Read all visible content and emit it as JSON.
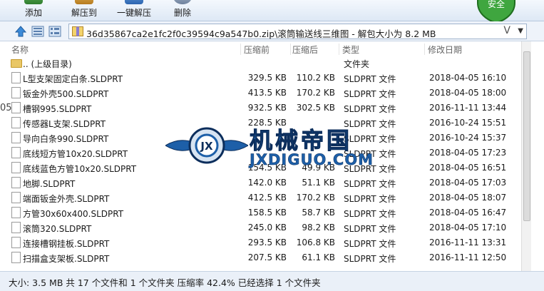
{
  "toolbar": {
    "buttons": [
      {
        "label": "添加",
        "icon": "add-icon",
        "color": "#3d8f3d"
      },
      {
        "label": "解压到",
        "icon": "extract-to-icon",
        "color": "#c08a2a"
      },
      {
        "label": "一键解压",
        "icon": "one-click-extract-icon",
        "color": "#3b78c4"
      },
      {
        "label": "删除",
        "icon": "delete-icon",
        "color": "#7c8ea8"
      }
    ],
    "shield_text": "安全"
  },
  "address": {
    "path": "36d35867ca2e1fc2f0c39594c9a547b0.zip\\滚筒输送线三维图 - 解包大小为 8.2 MB",
    "dropdown_glyph": "V"
  },
  "columns": {
    "name": "名称",
    "size": "压缩前",
    "packed": "压缩后",
    "type": "类型",
    "date": "修改日期"
  },
  "files": [
    {
      "name": ".. (上级目录)",
      "size": "",
      "packed": "",
      "type": "文件夹",
      "date": "",
      "folder": true
    },
    {
      "name": "L型支架固定白条.SLDPRT",
      "size": "329.5 KB",
      "packed": "110.2 KB",
      "type": "SLDPRT 文件",
      "date": "2018-04-05 16:10"
    },
    {
      "name": "钣金外壳500.SLDPRT",
      "size": "413.5 KB",
      "packed": "170.2 KB",
      "type": "SLDPRT 文件",
      "date": "2018-04-05 18:00"
    },
    {
      "name": "槽钢995.SLDPRT",
      "size": "932.5 KB",
      "packed": "302.5 KB",
      "type": "SLDPRT 文件",
      "date": "2016-11-11 13:44"
    },
    {
      "name": "传感器L支架.SLDPRT",
      "size": "228.5 KB",
      "packed": "",
      "type": "SLDPRT 文件",
      "date": "2016-10-24 15:51"
    },
    {
      "name": "导向白条990.SLDPRT",
      "size": "",
      "packed": "",
      "type": "SLDPRT 文件",
      "date": "2016-10-24 15:37"
    },
    {
      "name": "底线短方管10x20.SLDPRT",
      "size": "",
      "packed": "",
      "type": "SLDPRT 文件",
      "date": "2018-04-05 17:23"
    },
    {
      "name": "底线蓝色方管10x20.SLDPRT",
      "size": "154.5 KB",
      "packed": "49.9 KB",
      "type": "SLDPRT 文件",
      "date": "2018-04-05 16:51"
    },
    {
      "name": "地脚.SLDPRT",
      "size": "142.0 KB",
      "packed": "51.1 KB",
      "type": "SLDPRT 文件",
      "date": "2018-04-05 17:03"
    },
    {
      "name": "端面钣金外壳.SLDPRT",
      "size": "412.5 KB",
      "packed": "170.2 KB",
      "type": "SLDPRT 文件",
      "date": "2018-04-05 18:07"
    },
    {
      "name": "方管30x60x400.SLDPRT",
      "size": "158.5 KB",
      "packed": "58.7 KB",
      "type": "SLDPRT 文件",
      "date": "2018-04-05 16:47"
    },
    {
      "name": "滚筒320.SLDPRT",
      "size": "245.0 KB",
      "packed": "98.2 KB",
      "type": "SLDPRT 文件",
      "date": "2018-04-05 17:10"
    },
    {
      "name": "连接槽钢挂板.SLDPRT",
      "size": "293.5 KB",
      "packed": "106.8 KB",
      "type": "SLDPRT 文件",
      "date": "2016-11-11 13:31"
    },
    {
      "name": "扫描盒支架板.SLDPRT",
      "size": "207.5 KB",
      "packed": "61.1 KB",
      "type": "SLDPRT 文件",
      "date": "2016-11-11 12:50"
    }
  ],
  "status": "大小: 3.5 MB 共 17 个文件和 1 个文件夹 压缩率 42.4% 已经选择 1 个文件夹",
  "watermark": {
    "cn": "机械帝国",
    "en": "JXDIGUO.COM",
    "badge": "JX"
  },
  "left_edge_char": "05"
}
